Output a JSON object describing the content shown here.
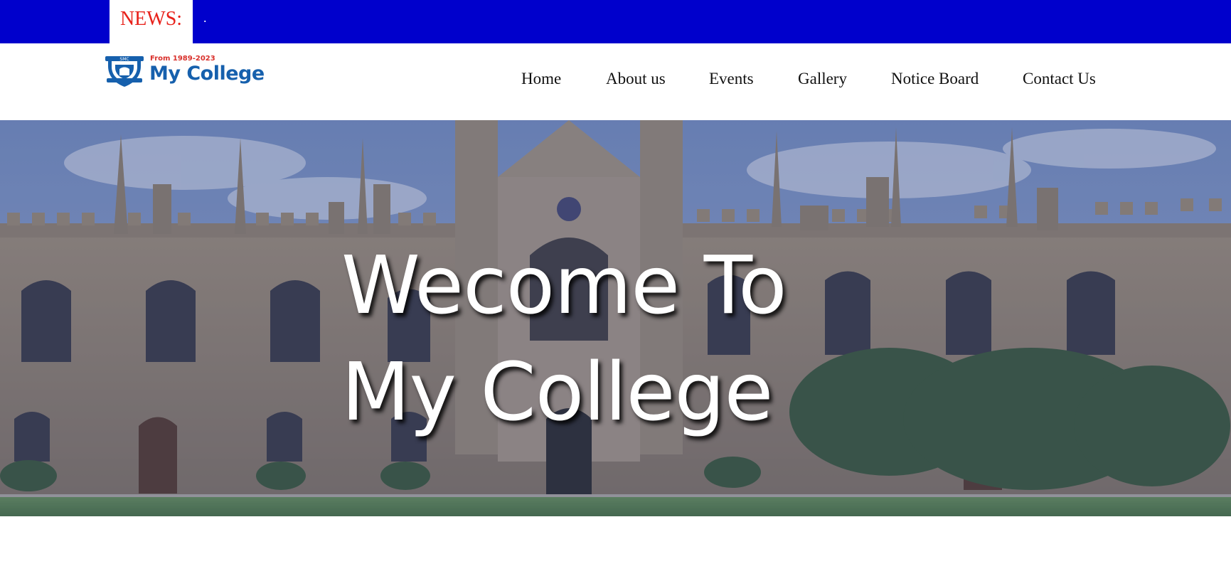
{
  "news": {
    "label": "NEWS:",
    "ticker": "."
  },
  "logo": {
    "since": "From 1989-2023",
    "name": "My College",
    "crest_text": "SMC"
  },
  "nav": {
    "items": [
      {
        "label": "Home"
      },
      {
        "label": "About us"
      },
      {
        "label": "Events"
      },
      {
        "label": "Gallery"
      },
      {
        "label": "Notice Board"
      },
      {
        "label": "Contact Us"
      }
    ]
  },
  "hero": {
    "line1": "Wecome To",
    "line2": "My College",
    "image": "college-building-photo"
  },
  "colors": {
    "newsbar": "#0000cc",
    "news_label": "#e8211a",
    "brand_blue": "#1660ad",
    "hero_overlay": "#2a3a78"
  }
}
